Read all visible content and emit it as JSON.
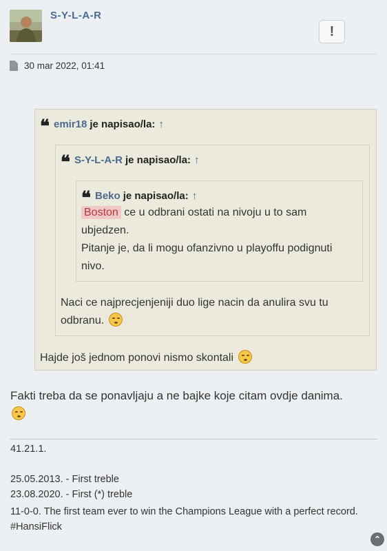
{
  "post": {
    "author": "S-Y-L-A-R",
    "report_icon": "!",
    "date": "30 mar 2022, 01:41"
  },
  "quotes": {
    "outer": {
      "user": "emir18",
      "said": "je napisao/la:",
      "arrow": "↑",
      "text": "Hajde još jednom ponovi nismo skontali"
    },
    "middle": {
      "user": "S-Y-L-A-R",
      "said": "je napisao/la:",
      "arrow": "↑",
      "text": "Naci ce najprecjenjeniji duo lige nacin da anulira svu tu odbranu."
    },
    "inner": {
      "user": "Beko",
      "said": "je napisao/la:",
      "arrow": "↑",
      "highlight": "Boston",
      "text1": " ce u odbrani ostati na nivoju u to sam ubjedzen.",
      "text2": "Pitanje je, da li mogu ofanzivno u playoffu podignuti nivo."
    }
  },
  "body_text": "Fakti treba da se ponavljaju a ne bajke koje citam ovdje danima.",
  "signature": {
    "line1": "41.21.1.",
    "line2": "25.05.2013. - First treble",
    "line3": "23.08.2020. - First (*) treble",
    "line4": "11-0-0. The first team ever to win the Champions League with a perfect record. #HansiFlick"
  },
  "icons": {
    "avatar": "avatar-photo",
    "file": "file-icon",
    "quote": "quote-icon",
    "emoji": "face-emoji",
    "scroll": "chevron-up-icon"
  }
}
